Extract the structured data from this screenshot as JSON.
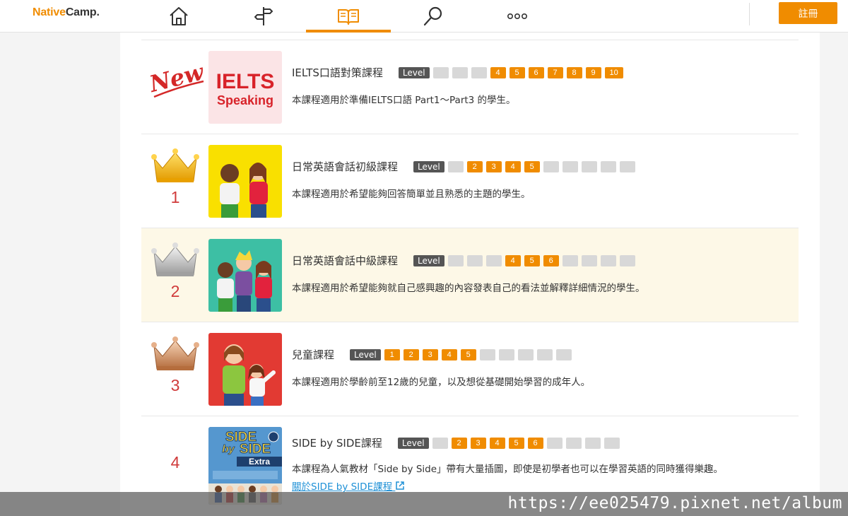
{
  "header": {
    "logo_part1": "Native",
    "logo_part2": "Camp.",
    "signup_label": "註冊",
    "nav": [
      {
        "icon": "home-icon"
      },
      {
        "icon": "signpost-icon"
      },
      {
        "icon": "book-icon",
        "active": true
      },
      {
        "icon": "search-icon"
      },
      {
        "icon": "more-icon"
      }
    ]
  },
  "level_label": "Level",
  "courses": [
    {
      "badge": "New",
      "thumb_text_1": "IELTS",
      "thumb_text_2": "Speaking",
      "title": "IELTS口語對策課程",
      "levels": [
        "",
        "",
        "",
        "4",
        "5",
        "6",
        "7",
        "8",
        "9",
        "10"
      ],
      "active_levels": [
        4,
        5,
        6,
        7,
        8,
        9,
        10
      ],
      "description": "本課程適用於準備IELTS口語 Part1～Part3 的學生。"
    },
    {
      "rank": "1",
      "title": "日常英語會話初級課程",
      "levels": [
        "",
        "2",
        "3",
        "4",
        "5",
        "",
        "",
        "",
        "",
        ""
      ],
      "active_levels": [
        2,
        3,
        4,
        5
      ],
      "description": "本課程適用於希望能夠回答簡單並且熟悉的主題的學生。"
    },
    {
      "rank": "2",
      "title": "日常英語會話中級課程",
      "levels": [
        "",
        "",
        "",
        "4",
        "5",
        "6",
        "",
        "",
        "",
        ""
      ],
      "active_levels": [
        4,
        5,
        6
      ],
      "description": "本課程適用於希望能夠就自己感興趣的內容發表自己的看法並解釋詳細情況的學生。"
    },
    {
      "rank": "3",
      "title": "兒童課程",
      "levels": [
        "1",
        "2",
        "3",
        "4",
        "5",
        "",
        "",
        "",
        "",
        ""
      ],
      "active_levels": [
        1,
        2,
        3,
        4,
        5
      ],
      "description": "本課程適用於學齡前至12歲的兒童，以及想從基礎開始學習的成年人。"
    },
    {
      "rank": "4",
      "thumb_text_1": "SIDE",
      "thumb_text_2": "by",
      "thumb_text_3": "SIDE",
      "thumb_text_4": "Extra",
      "title": "SIDE by SIDE課程",
      "levels": [
        "",
        "2",
        "3",
        "4",
        "5",
        "6",
        "",
        "",
        "",
        ""
      ],
      "active_levels": [
        2,
        3,
        4,
        5,
        6
      ],
      "description": "本課程為人氣教材「Side by Side」帶有大量插圖，即使是初學者也可以在學習英語的同時獲得樂趣。",
      "link": "關於SIDE by SIDE課程"
    }
  ],
  "watermark": "https://ee025479.pixnet.net/album",
  "colors": {
    "accent": "#f08c00",
    "rank_red": "#d03a3a",
    "link": "#1e90d6",
    "highlight": "#fdf8e7"
  }
}
